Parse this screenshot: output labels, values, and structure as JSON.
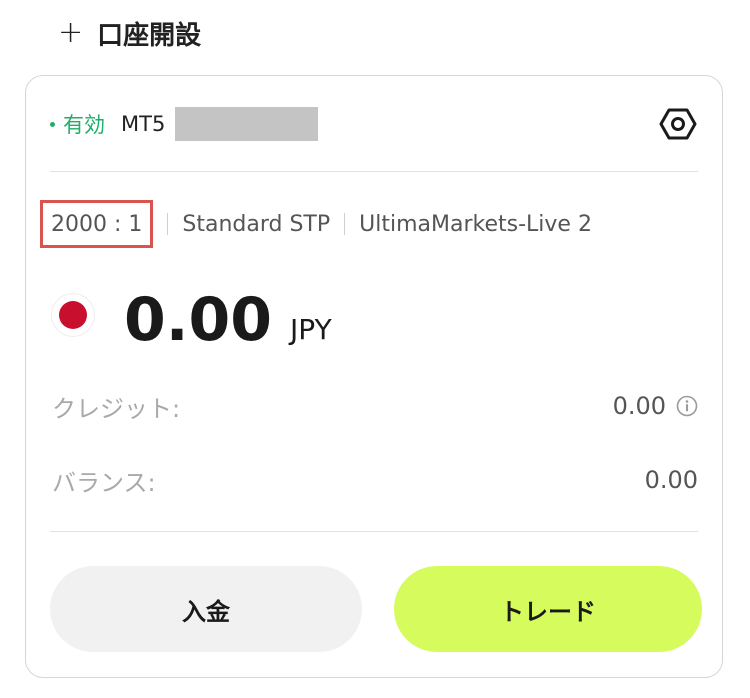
{
  "header": {
    "plus_icon": "plus-icon",
    "open_account_label": "口座開設"
  },
  "account": {
    "status_label": "有効",
    "status_color": "#1fae6a",
    "platform": "MT5",
    "settings_icon": "settings-hexagon-icon",
    "leverage": "2000 : 1",
    "account_type": "Standard STP",
    "server": "UltimaMarkets-Live 2",
    "flag_icon": "japan-flag-icon",
    "balance_amount": "0.00",
    "currency": "JPY",
    "credit_label": "クレジット:",
    "credit_value": "0.00",
    "credit_info_icon": "info-icon",
    "balance_label": "バランス:",
    "balance_value": "0.00"
  },
  "actions": {
    "deposit_label": "入金",
    "trade_label": "トレード",
    "trade_color": "#d5fb5c"
  }
}
